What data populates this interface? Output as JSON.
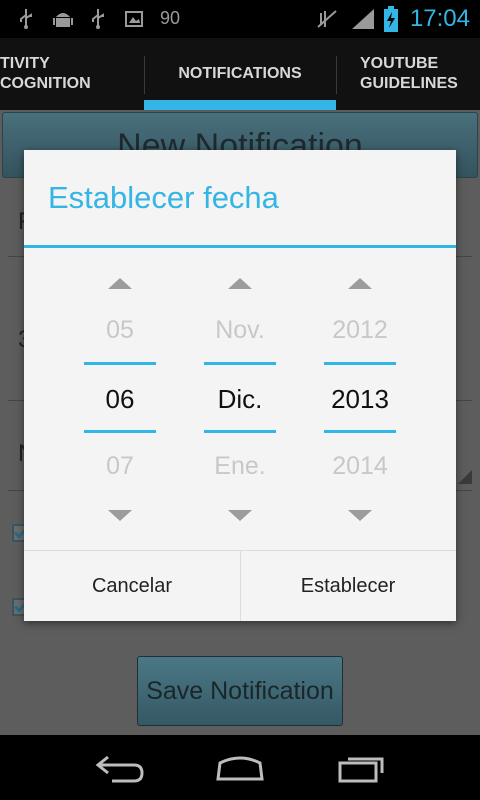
{
  "status_bar": {
    "battery_level_text": "90",
    "time": "17:04",
    "icons": [
      "usb-icon",
      "android-debug-icon",
      "usb-icon",
      "photo-notification-icon",
      "mute-icon",
      "signal-icon",
      "battery-charging-icon"
    ]
  },
  "tabs": [
    {
      "label_line1": "TIVITY",
      "label_line2": "COGNITION"
    },
    {
      "label_line1": "NOTIFICATIONS",
      "label_line2": ""
    },
    {
      "label_line1": "YOUTUBE",
      "label_line2": "GUIDELINES"
    }
  ],
  "app": {
    "header_button": "New Notification",
    "row1_letter": "F",
    "row2_letter": "3",
    "row3_letter": "N",
    "save_button": "Save Notification"
  },
  "dialog": {
    "title": "Establecer fecha",
    "day": {
      "prev": "05",
      "current": "06",
      "next": "07"
    },
    "month": {
      "prev": "Nov.",
      "current": "Dic.",
      "next": "Ene."
    },
    "year": {
      "prev": "2012",
      "current": "2013",
      "next": "2014"
    },
    "cancel": "Cancelar",
    "set": "Establecer"
  },
  "colors": {
    "accent": "#33b5e5",
    "dialog_bg": "#f4f4f4",
    "dim_overlay": "#5d5d5d"
  }
}
